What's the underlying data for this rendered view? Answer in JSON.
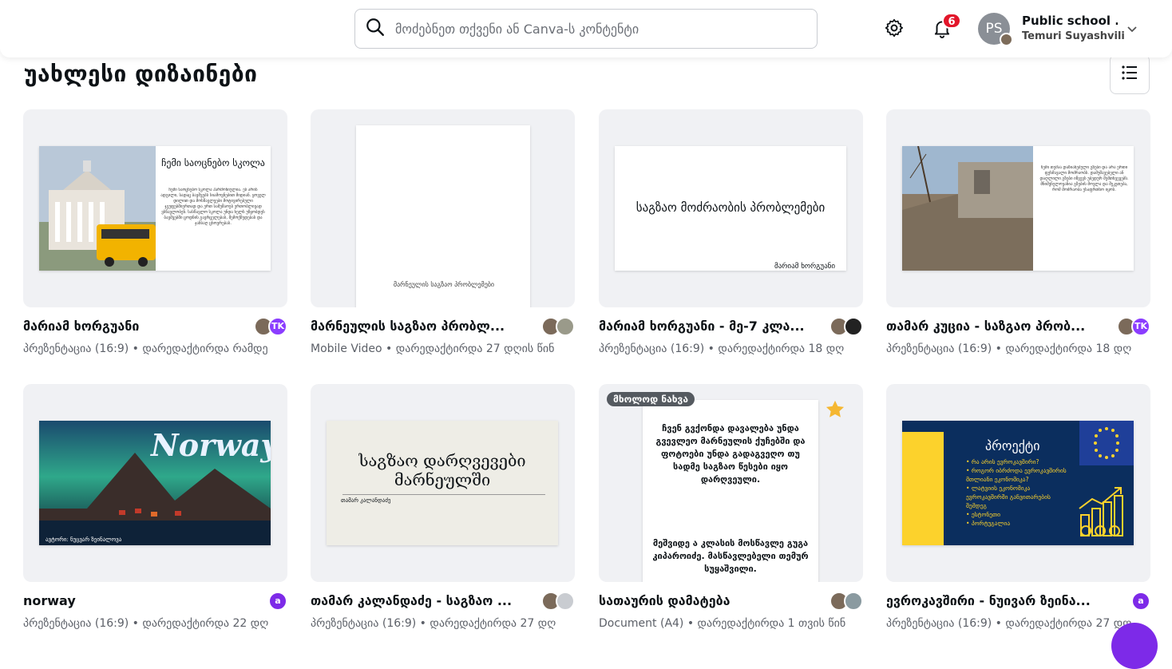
{
  "search": {
    "placeholder": "მოძებნეთ თქვენი ან Canva-ს კონტენტი"
  },
  "notifications": {
    "count": "6"
  },
  "account": {
    "initials": "PS",
    "name": "Public school ...",
    "user": "Temuri Suyashvili"
  },
  "section": {
    "title": "უახლესი დიზაინები"
  },
  "icons": {
    "search": "search-icon",
    "settings": "gear-icon",
    "notifications": "bell-icon",
    "chevron": "chevron-down-icon",
    "list": "list-view-icon",
    "star": "star-icon"
  },
  "colors": {
    "accent": "#7d2ae8",
    "badge": "#e2162a",
    "tk_avatar": "#8b3dff",
    "a_avatar": "#7d2ae8",
    "eu_blue": "#0b2e5e",
    "eu_yellow": "#fcd22c",
    "star": "#f5b731"
  },
  "designs": [
    {
      "title": "მარიამ ხორგუანი",
      "meta": "პრეზენტაცია (16:9) • დარედაქტირდა რამდე",
      "collab_badge": "TK",
      "slide_title": "ჩემი საოცნებო სკოლა",
      "slide_body": "ჩემი საოცნებო სკოლა ჰარმონიულია. ეს არის ადგილი, სადაც ბავშვებს სიამოვნებით მიდიან. ყოველ დილით და მოსწავლეები მოტივირებული ჯგუფებშიერთად და ერთ სამუშაოებ ერთობლივად ვსწავლობენ. სასწავლო სკოლა უნდა ხელს უწყობდეს ბავშვებში ცოდნის გავრცელებას, შემოქმედებას და ჯანსაღ ცხოვრებას."
    },
    {
      "title": "მარნეულის საგზაო პრობლ...",
      "meta": "Mobile Video • დარედაქტირდა 27 დღის წინ",
      "slide_text": "მარნეულის საგზაო პრობლემები"
    },
    {
      "title": "მარიამ ხორგუანი - მე-7 კლა...",
      "meta": "პრეზენტაცია (16:9) • დარედაქტირდა 18 დღ",
      "slide_title": "საგზაო მოძრაობის პრობლემები",
      "slide_author": "მარიამ ხორგუანი"
    },
    {
      "title": "თამარ კუცია - საზგაო პრობ...",
      "meta": "პრეზენტაცია (16:9) • დარედაქტირდა 18 დღ",
      "collab_badge": "TK",
      "slide_body": "ჩემი თემაა დაზიანებული გზები და არა ერთი ფეხმავალი მოძრაობს. დამუშავებელი ან დაღლილი გზები იწვევს უბედურ შემთხვევებს. მნიშვნელოვანია გზების მოვლა და შეკეთება, რომ მოძრაობა უსაფრთხო იყოს."
    },
    {
      "title": "norway",
      "meta": "პრეზენტაცია (16:9) • დარედაქტირდა 22 დღ",
      "collab_badge": "a",
      "slide_title": "Norway",
      "slide_author": "ავტორი: ნუცვარ ზეინალოვა"
    },
    {
      "title": "თამარ კალანდაძე - საგზაო ...",
      "meta": "პრეზენტაცია (16:9) • დარედაქტირდა 27 დღ",
      "slide_title": "საგზაო დარღვევები მარნეულში",
      "slide_author": "თამარ კალანდაძე"
    },
    {
      "title": "სათაურის დამატება",
      "meta": "Document (A4) • დარედაქტირდა 1 თვის წინ",
      "badge": "მხოლოდ ნახვა",
      "slide_para1": "ჩვენ გვქონდა დავალება უნდა გვევლეო მარნეულის ქუჩებში და ფოტოები უნდა გადაგვეღო თუ სადმე საგზაო წესები იყო დარღვეული.",
      "slide_para2": "მეშვიდე ა კლასის მოსწავლე გუგა კიპაროიძე. მასწავლებელი თემურ სუყაშვილი."
    },
    {
      "title": "ევროკავშირი - ნუივარ ზეინა...",
      "meta": "პრეზენტაცია (16:9) • დარედაქტირდა 27 დღ",
      "collab_badge": "a",
      "slide_title": "პროექტი",
      "slide_bullets": [
        "რა არის ევროკავშირი?",
        "როგორ იბრძოდა ევროკავშირის მთლიანი ეკონომიკა?",
        "ლატვიის ეკონომიკა ევროკავშირში განვითარების შემდეგ",
        "ესტონეთი",
        "პორტუგალია"
      ]
    }
  ]
}
